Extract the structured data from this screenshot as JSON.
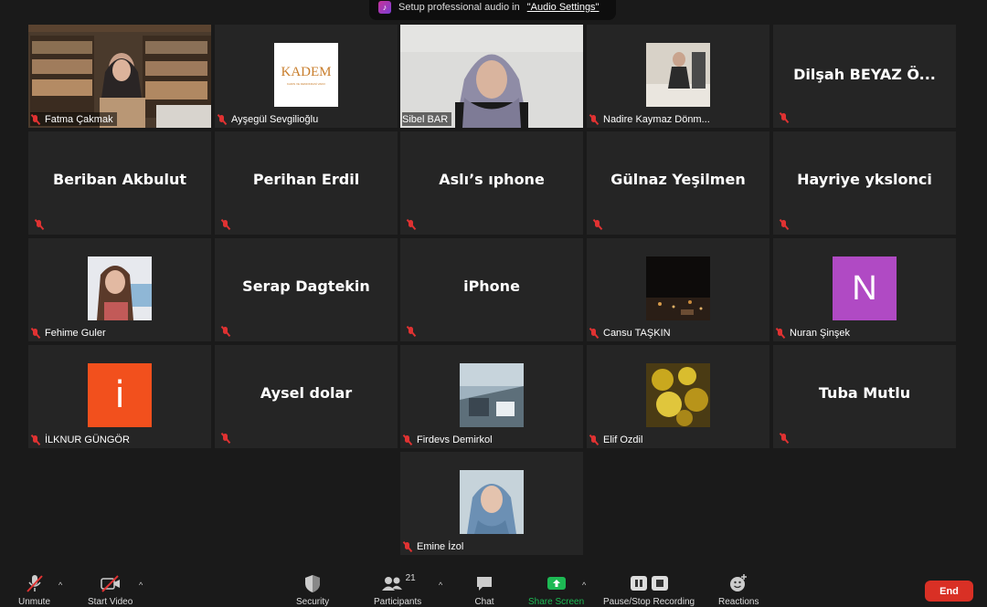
{
  "banner": {
    "text": "Setup professional audio in",
    "link": "\"Audio Settings\""
  },
  "tiles": {
    "fatma": "Fatma Çakmak",
    "aysegul": "Ayşegül Sevgilioğlu",
    "sibel": "Sibel BAR",
    "nadire": "Nadire Kaymaz Dönm...",
    "dilsah": "Dilşah  BEYAZ  Ö...",
    "beriban": "Beriban Akbulut",
    "perihan": "Perihan Erdil",
    "asli": "Aslı’s ıphone",
    "gulnaz": "Gülnaz Yeşilmen",
    "hayriye": "Hayriye ykslonci",
    "fehime": "Fehime Guler",
    "serap": "Serap Dagtekin",
    "iphone": "iPhone",
    "cansu": "Cansu TAŞKIN",
    "nuran": "Nuran Şinşek",
    "ilknur": "İLKNUR GÜNGÖR",
    "aysel": "Aysel dolar",
    "firdevs": "Firdevs Demirkol",
    "elif": "Elif Ozdil",
    "tuba": "Tuba Mutlu",
    "emine": "Emine İzol"
  },
  "avatars": {
    "nuran_letter": "N",
    "ilknur_letter": "i",
    "kadem_logo": "KADEM",
    "kadem_sub": "KADIN VE DEMOKRASİ VAKFI"
  },
  "toolbar": {
    "unmute": "Unmute",
    "start_video": "Start Video",
    "security": "Security",
    "participants": "Participants",
    "participants_count": "21",
    "chat": "Chat",
    "share_screen": "Share Screen",
    "recording": "Pause/Stop Recording",
    "reactions": "Reactions",
    "end": "End"
  },
  "colors": {
    "accent_green": "#1db954",
    "end_red": "#d93025",
    "active_border": "#dfe86a",
    "mic_off": "#e03232",
    "nuran_bg": "#b04ac4",
    "ilknur_bg": "#f2501d"
  }
}
